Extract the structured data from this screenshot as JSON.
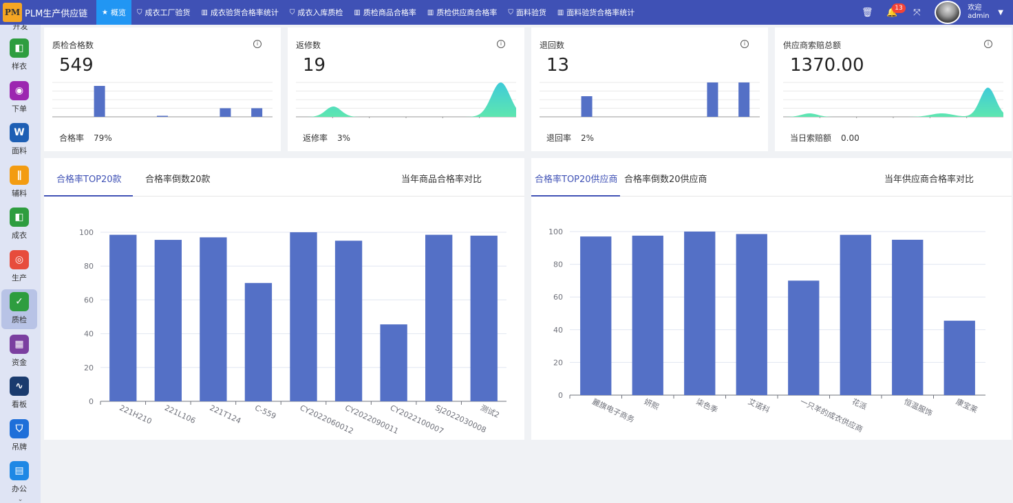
{
  "app": {
    "title": "PLM生产供应链",
    "logo_text": "PM"
  },
  "nav": [
    {
      "label": "概览",
      "icon": "★",
      "active": true
    },
    {
      "label": "成衣工厂验货",
      "icon": "⛉"
    },
    {
      "label": "成衣验货合格率统计",
      "icon": "▥"
    },
    {
      "label": "成衣入库质检",
      "icon": "⛉"
    },
    {
      "label": "质检商品合格率",
      "icon": "▥"
    },
    {
      "label": "质检供应商合格率",
      "icon": "▥"
    },
    {
      "label": "面料验货",
      "icon": "⛉"
    },
    {
      "label": "面料验货合格率统计",
      "icon": "▥"
    }
  ],
  "header_right": {
    "notification_count": "13",
    "welcome": "欢迎",
    "username": "admin"
  },
  "sidebar": {
    "top_label": "开发",
    "items": [
      {
        "label": "样衣",
        "icon": "shirt-icon",
        "glyph": "◧",
        "color": "#2e9d3f"
      },
      {
        "label": "下单",
        "icon": "disc-icon",
        "glyph": "◉",
        "color": "#9c27b0"
      },
      {
        "label": "面料",
        "icon": "fabric-icon",
        "glyph": "W",
        "color": "#1e5fb4"
      },
      {
        "label": "辅料",
        "icon": "accessory-icon",
        "glyph": "∥",
        "color": "#f39c12"
      },
      {
        "label": "成衣",
        "icon": "garment-icon",
        "glyph": "◧",
        "color": "#2e9d3f"
      },
      {
        "label": "生产",
        "icon": "production-icon",
        "glyph": "◎",
        "color": "#e74c3c"
      },
      {
        "label": "质检",
        "icon": "quality-icon",
        "glyph": "✓",
        "color": "#2e9d3f",
        "active": true
      },
      {
        "label": "资金",
        "icon": "calculator-icon",
        "glyph": "▦",
        "color": "#7b3fa0"
      },
      {
        "label": "看板",
        "icon": "dashboard-icon",
        "glyph": "∿",
        "color": "#1a3b6e"
      },
      {
        "label": "吊牌",
        "icon": "tag-icon",
        "glyph": "⛉",
        "color": "#1e6fd9"
      },
      {
        "label": "办公",
        "icon": "office-icon",
        "glyph": "▤",
        "color": "#1e88e5"
      }
    ],
    "more": "⌄"
  },
  "stats": [
    {
      "title": "质检合格数",
      "value": "549",
      "foot_label": "合格率",
      "foot_value": "79%",
      "chart": "bar",
      "bars": [
        0,
        0.9,
        0,
        0.03,
        0,
        0.25,
        0.25
      ]
    },
    {
      "title": "返修数",
      "value": "19",
      "foot_label": "返修率",
      "foot_value": "3%",
      "chart": "area",
      "peaks": [
        {
          "pos": 0.17,
          "h": 0.3,
          "w": 0.05
        },
        {
          "pos": 0.93,
          "h": 1.0,
          "w": 0.06
        }
      ]
    },
    {
      "title": "退回数",
      "value": "13",
      "foot_label": "退回率",
      "foot_value": "2%",
      "chart": "bar",
      "bars": [
        0,
        0.6,
        0,
        0,
        0,
        1.0,
        1.0
      ]
    },
    {
      "title": "供应商索赔总额",
      "value": "1370.00",
      "foot_label": "当日索赔额",
      "foot_value": "0.00",
      "chart": "area",
      "peaks": [
        {
          "pos": 0.12,
          "h": 0.1,
          "w": 0.05
        },
        {
          "pos": 0.72,
          "h": 0.1,
          "w": 0.07
        },
        {
          "pos": 0.93,
          "h": 0.85,
          "w": 0.05
        }
      ]
    }
  ],
  "panel_left": {
    "tabs": [
      "合格率TOP20款",
      "合格率倒数20款"
    ],
    "right_link": "当年商品合格率对比",
    "chart_data": {
      "type": "bar",
      "categories": [
        "221H210",
        "221L106",
        "221T124",
        "C-559",
        "CY2022060012",
        "CY2022090011",
        "CY2022100007",
        "SJ2022030008",
        "测试2"
      ],
      "values": [
        98.5,
        95.5,
        97,
        70,
        100,
        95,
        45.5,
        98.5,
        98
      ],
      "ylim": [
        0,
        100
      ],
      "yticks": [
        "0",
        "20",
        "40",
        "60",
        "80",
        "100"
      ],
      "color": "#5470c6"
    }
  },
  "panel_right": {
    "tabs": [
      "合格率TOP20供应商",
      "合格率倒数20供应商"
    ],
    "right_link": "当年供应商合格率对比",
    "chart_data": {
      "type": "bar",
      "categories": [
        "麗旗电子商务",
        "妍熙",
        "柒色季",
        "艾诺科",
        "一只羊的成衣供应商",
        "花派",
        "恒温服饰",
        "康宝莱"
      ],
      "values": [
        97,
        97.5,
        100,
        98.5,
        70,
        98,
        95,
        45.5
      ],
      "ylim": [
        0,
        100
      ],
      "yticks": [
        "0",
        "20",
        "40",
        "60",
        "80",
        "100"
      ],
      "color": "#5470c6"
    }
  }
}
